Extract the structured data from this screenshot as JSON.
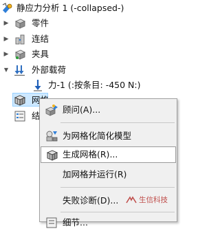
{
  "tree": {
    "root": "静应力分析 1 (-collapsed-)",
    "parts": "零件",
    "connections": "连结",
    "fixtures": "夹具",
    "external_loads": "外部载荷",
    "force": "力-1 (:按条目: -450 N:)",
    "mesh": "网格",
    "results": "结"
  },
  "menu": {
    "advisor": "顾问(A)...",
    "simplify": "为网格化简化模型",
    "create_mesh": "生成网格(R)...",
    "mesh_and_run": "加网格并运行(R)",
    "diagnosis": "失败诊断(D)...",
    "last": "细节..."
  },
  "watermark": "生信科技",
  "colors": {
    "highlight": "#cde8ff",
    "menu_bg": "#f0f0f0",
    "accent": "#1f6fc5"
  }
}
